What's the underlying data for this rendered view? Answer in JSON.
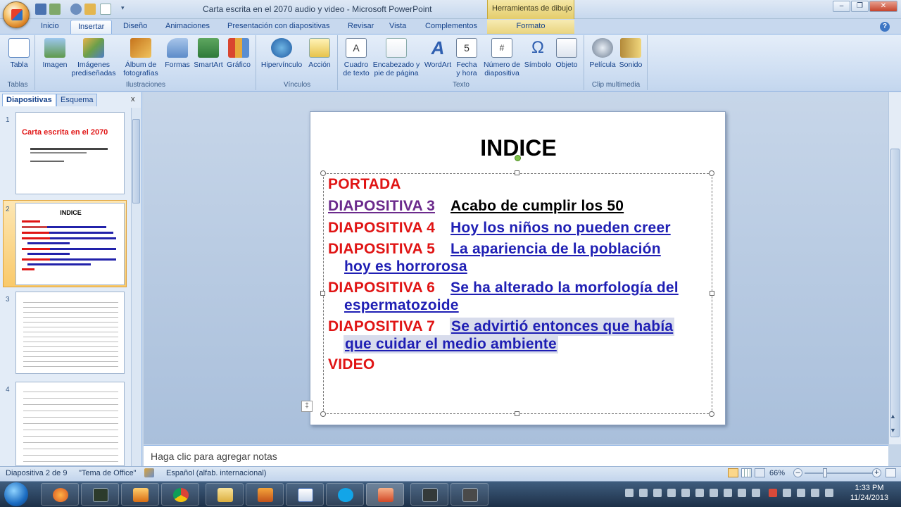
{
  "window": {
    "title": "Carta escrita en el 2070 audio y video - Microsoft PowerPoint",
    "context_tab": "Herramientas de dibujo"
  },
  "tabs": [
    "Inicio",
    "Insertar",
    "Diseño",
    "Animaciones",
    "Presentación con diapositivas",
    "Revisar",
    "Vista",
    "Complementos",
    "Formato"
  ],
  "ribbon": {
    "buttons": {
      "tabla": "Tabla",
      "imagen": "Imagen",
      "imagenes1": "Imágenes",
      "imagenes2": "prediseñadas",
      "album1": "Álbum de",
      "album2": "fotografías",
      "formas": "Formas",
      "smartart": "SmartArt",
      "grafico": "Gráfico",
      "hipervinculo": "Hipervínculo",
      "accion": "Acción",
      "cuadro1": "Cuadro",
      "cuadro2": "de texto",
      "encabezado1": "Encabezado y",
      "encabezado2": "pie de página",
      "wordart": "WordArt",
      "fecha1": "Fecha",
      "fecha2": "y hora",
      "numero1": "Número de",
      "numero2": "diapositiva",
      "simbolo": "Símbolo",
      "objeto": "Objeto",
      "pelicula": "Película",
      "sonido": "Sonido"
    },
    "groups": {
      "tablas": "Tablas",
      "ilustraciones": "Ilustraciones",
      "vinculos": "Vínculos",
      "texto": "Texto",
      "multimedia": "Clip multimedia"
    }
  },
  "left_panel": {
    "tabs": [
      "Diapositivas",
      "Esquema"
    ],
    "close": "x",
    "thumb1": {
      "title": "Carta escrita en el 2070"
    },
    "thumb2": {
      "title": "INDICE"
    },
    "numbers": [
      "1",
      "2",
      "3",
      "4"
    ]
  },
  "slide": {
    "title": "INDICE",
    "items": {
      "portada": "PORTADA",
      "d3_label": "DIAPOSITIVA 3",
      "d3_text": "Acabo de cumplir los 50",
      "d4_label": "DIAPOSITIVA 4",
      "d4_text": "Hoy los niños no pueden creer",
      "d5_label": "DIAPOSITIVA 5",
      "d5_text1": "La apariencia de la población",
      "d5_text2": "hoy es horrorosa",
      "d6_label": "DIAPOSITIVA 6",
      "d6_text1": "Se ha alterado la morfología del",
      "d6_text2": "espermatozoide",
      "d7_label": "DIAPOSITIVA 7",
      "d7_text1": "Se advirtió entonces que había",
      "d7_text2": "que cuidar el medio ambiente",
      "video": "VIDEO"
    }
  },
  "notes_placeholder": "Haga clic para agregar notas",
  "status": {
    "slide": "Diapositiva 2 de 9",
    "theme": "\"Tema de Office\"",
    "language": "Español (alfab. internacional)",
    "zoom": "66%"
  },
  "clock": {
    "time": "1:33 PM",
    "date": "11/24/2013"
  },
  "colors": {
    "accent_red": "#e01414",
    "link_blue": "#1f1fb4",
    "ribbon": "#d1e0f3"
  }
}
